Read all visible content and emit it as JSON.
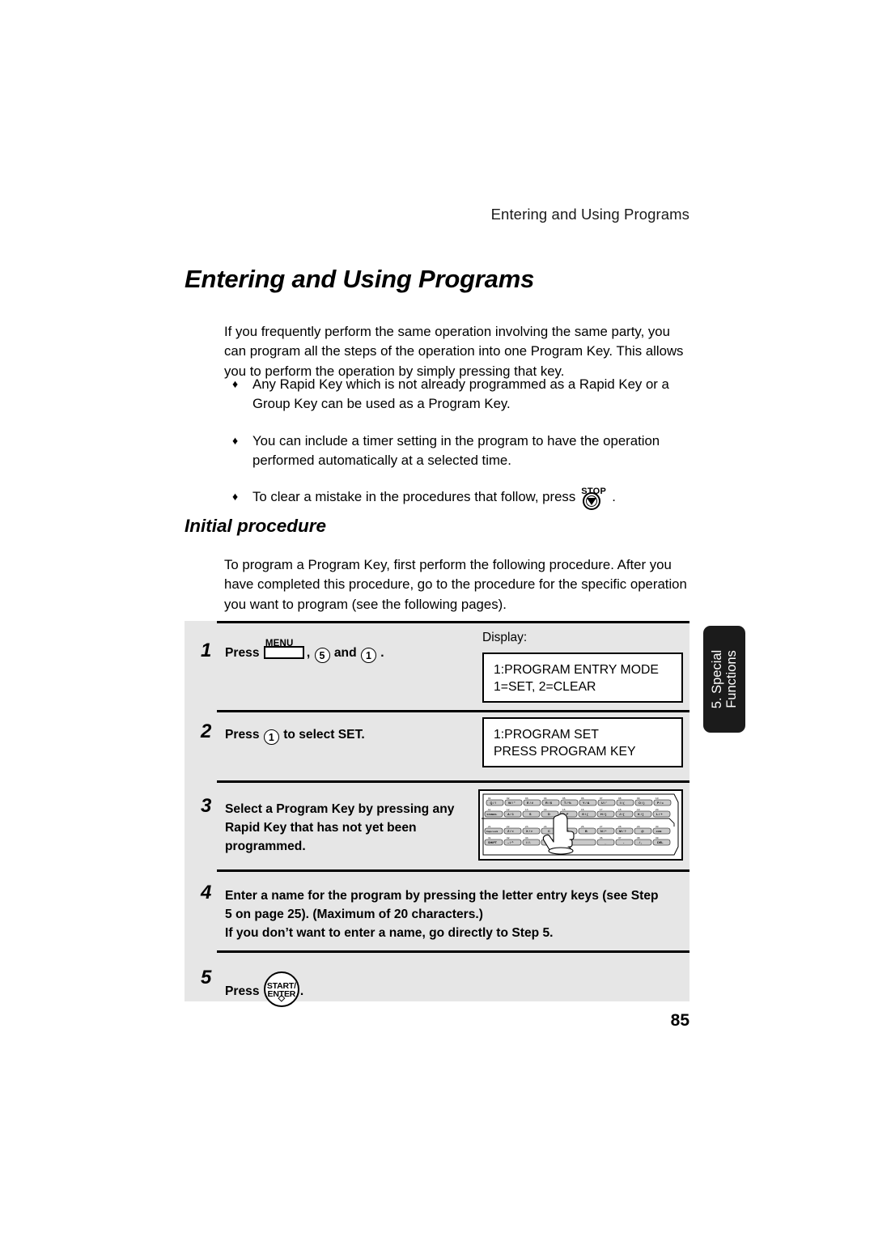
{
  "header": {
    "running_title": "Entering and Using Programs"
  },
  "title": "Entering and Using Programs",
  "intro": {
    "paragraph": "If you frequently perform the same operation involving the same party, you can program all the steps of the operation into one Program Key. This allows you to perform the operation by simply pressing that key."
  },
  "bullets": [
    {
      "mark": "♦",
      "text": "Any Rapid Key which is not already programmed as a Rapid Key or a Group Key can be used as a Program Key."
    },
    {
      "mark": "♦",
      "text": "You can include a timer setting in the program to have the operation performed automatically at a selected time."
    },
    {
      "mark": "♦",
      "text_before": "To clear a mistake in the procedures that follow, press",
      "key_label": "STOP",
      "text_after": "."
    }
  ],
  "section": {
    "heading": "Initial procedure",
    "paragraph": "To program a Program Key, first perform the following procedure. After you have completed this procedure, go to the procedure for the specific operation you want to program (see the following pages)."
  },
  "steps": {
    "display_label": "Display:",
    "step1": {
      "number": "1",
      "press_word": "Press",
      "menu_key_label": "MENU",
      "comma": ",",
      "key_5": "5",
      "and_word": "and",
      "key_1": "1",
      "period": ".",
      "display_line1": "1:PROGRAM ENTRY MODE",
      "display_line2": "1=SET, 2=CLEAR"
    },
    "step2": {
      "number": "2",
      "press_word": "Press",
      "key_1": "1",
      "tail": "to select SET.",
      "display_line1": "1:PROGRAM SET",
      "display_line2": "PRESS PROGRAM KEY"
    },
    "step3": {
      "number": "3",
      "line1": "Select a Program Key by pressing any",
      "line2": "Rapid Key that has not yet been",
      "line3": "programmed."
    },
    "step4": {
      "number": "4",
      "line1": "Enter a name for the program by pressing the letter entry keys (see Step",
      "line2": "5 on page 25). (Maximum of 20 characters.)",
      "line3": "If you don’t want to enter a name, go directly to Step 5."
    },
    "step5": {
      "number": "5",
      "press_word": "Press",
      "start_key_line1": "START/",
      "start_key_line2": "ENTER",
      "start_key_symbol": "◇",
      "period": "."
    }
  },
  "keyboard": {
    "rows": [
      {
        "numbers": [
          "01",
          "02",
          "03",
          "04",
          "05",
          "06",
          "07",
          "08",
          "09",
          "10"
        ],
        "keys": [
          "Q / !",
          "W / \"",
          "E / #",
          "R / $",
          "T / %",
          "Y / &",
          "U / '",
          "I / (",
          "O / )",
          "P / ="
        ]
      },
      {
        "numbers": [
          "11",
          "12",
          "13",
          "14",
          "15",
          "16",
          "17",
          "18",
          "19",
          "20"
        ],
        "keys": [
          "SYMBOL",
          "A / 1",
          "S",
          "D",
          "F",
          "G / {",
          "H / }",
          "J / [",
          "K / ]",
          "L / +"
        ]
      },
      {
        "numbers": [
          "21",
          "22",
          "23",
          "24",
          "25",
          "26",
          "27",
          "28",
          "29",
          "30"
        ],
        "keys": [
          "Caps Lock",
          "Z / <",
          "X / >",
          "C",
          "V",
          "B",
          "N / *",
          "M / ?",
          "@",
          "COM"
        ]
      },
      {
        "numbers": [
          "31",
          "32",
          "33",
          "34",
          "",
          "",
          "36",
          "37",
          "38",
          "39"
        ],
        "keys": [
          "SHIFT",
          "– / ^",
          "/ / \\",
          ": / ;",
          "",
          "_",
          "-",
          ". / ,",
          "DEL"
        ]
      }
    ]
  },
  "side_tab": {
    "line1": "5. Special",
    "line2": "Functions"
  },
  "page_number": "85",
  "colors": {
    "panel_bg": "#e6e6e6",
    "tab_bg": "#1b1b1b",
    "key_fill": "#c9c9c9",
    "text": "#000000"
  }
}
